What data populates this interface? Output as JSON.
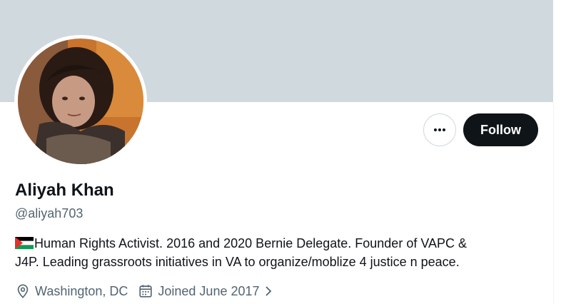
{
  "profile": {
    "name": "Aliyah Khan",
    "handle": "@aliyah703",
    "bio_line1": "Human Rights Activist. 2016 and 2020 Bernie Delegate.   Founder of VAPC &",
    "bio_line2": "J4P. Leading grassroots initiatives in VA to organize/moblize 4 justice n peace.",
    "location": "Washington, DC",
    "joined": "Joined June 2017"
  },
  "actions": {
    "follow_label": "Follow",
    "more_icon": "more-horizontal-icon"
  },
  "icons": {
    "flag": "palestine-flag-icon",
    "location": "location-pin-icon",
    "calendar": "calendar-icon",
    "chevron": "chevron-right-icon"
  },
  "colors": {
    "banner": "#cfd9de",
    "text_primary": "#0f1419",
    "text_secondary": "#536471",
    "follow_bg": "#0f1419"
  }
}
